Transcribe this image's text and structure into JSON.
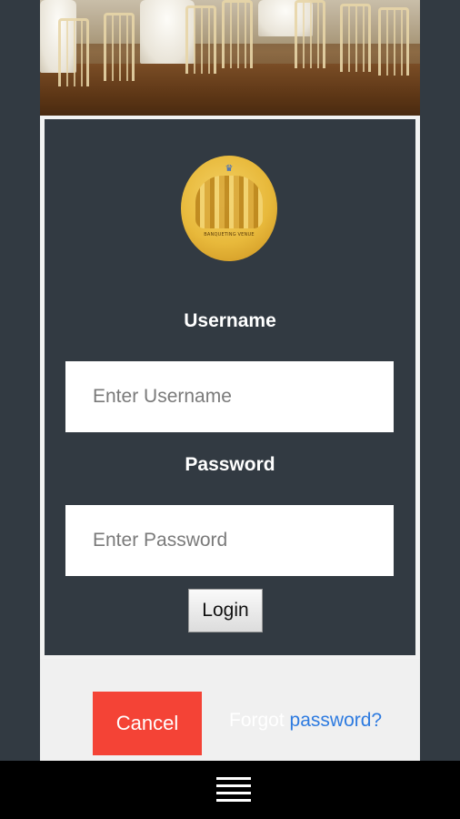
{
  "login": {
    "username_label": "Username",
    "username_placeholder": "Enter Username",
    "username_value": "",
    "password_label": "Password",
    "password_placeholder": "Enter Password",
    "password_value": "",
    "login_button": "Login"
  },
  "logo": {
    "tagline": "BANQUETING VENUE"
  },
  "footer": {
    "cancel_button": "Cancel",
    "forgot_prefix": "Forgot",
    "forgot_link": "password?"
  },
  "icons": {
    "menu": "hamburger-menu-icon",
    "crown": "crown-icon"
  },
  "colors": {
    "background": "#323a42",
    "cancel": "#f44336",
    "link": "#2e7be0",
    "logo_gold": "#e8b93b"
  }
}
